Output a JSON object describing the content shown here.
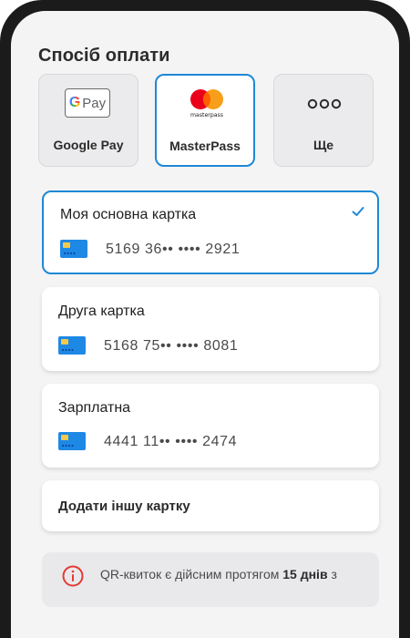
{
  "header": {
    "title": "Спосіб оплати"
  },
  "methods": [
    {
      "label": "Google Pay",
      "logo_text": "Pay",
      "logo_g": "G"
    },
    {
      "label": "MasterPass",
      "logo_text": "masterpass"
    },
    {
      "label": "Ще",
      "icon": "more-dots-icon",
      "glyph": "ooo"
    }
  ],
  "selected_method": "MasterPass",
  "cards": [
    {
      "name": "Моя основна картка",
      "number": "5169 36•• •••• 2921",
      "selected": true
    },
    {
      "name": "Друга картка",
      "number": "5168 75•• •••• 8081",
      "selected": false
    },
    {
      "name": "Зарплатна",
      "number": "4441 11•• •••• 2474",
      "selected": false
    }
  ],
  "add_card": {
    "label": "Додати іншу картку"
  },
  "notice": {
    "text_before": "QR-квиток є дійсним протягом ",
    "text_bold": "15 днів",
    "text_after": " з"
  },
  "colors": {
    "accent": "#1e88d6",
    "card_icon": "#1e88e5",
    "card_chip": "#f2c94c",
    "info_icon": "#e53935",
    "mastercard_red": "#eb001b",
    "mastercard_yellow": "#f79e1b"
  }
}
